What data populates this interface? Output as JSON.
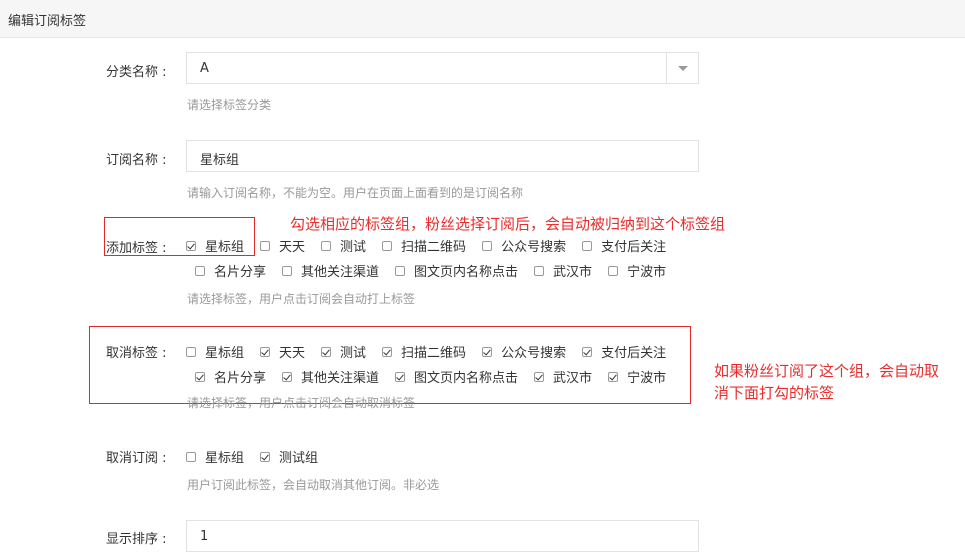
{
  "header": {
    "title": "编辑订阅标签"
  },
  "category": {
    "label": "分类名称 :",
    "value": "A",
    "hint": "请选择标签分类"
  },
  "sub_name": {
    "label": "订阅名称 :",
    "value": "星标组",
    "hint": "请输入订阅名称，不能为空。用户在页面上面看到的是订阅名称"
  },
  "add_tags": {
    "label": "添加标签 :",
    "hint": "请选择标签，用户点击订阅会自动打上标签",
    "row1": [
      {
        "label": "星标组",
        "checked": true
      },
      {
        "label": "天天",
        "checked": false
      },
      {
        "label": "测试",
        "checked": false
      },
      {
        "label": "扫描二维码",
        "checked": false
      },
      {
        "label": "公众号搜索",
        "checked": false
      },
      {
        "label": "支付后关注",
        "checked": false
      }
    ],
    "row2": [
      {
        "label": "名片分享",
        "checked": false
      },
      {
        "label": "其他关注渠道",
        "checked": false
      },
      {
        "label": "图文页内名称点击",
        "checked": false
      },
      {
        "label": "武汉市",
        "checked": false
      },
      {
        "label": "宁波市",
        "checked": false
      }
    ]
  },
  "remove_tags": {
    "label": "取消标签 :",
    "hint": "请选择标签，用户点击订阅会自动取消标签",
    "row1": [
      {
        "label": "星标组",
        "checked": false
      },
      {
        "label": "天天",
        "checked": true
      },
      {
        "label": "测试",
        "checked": true
      },
      {
        "label": "扫描二维码",
        "checked": true
      },
      {
        "label": "公众号搜索",
        "checked": true
      },
      {
        "label": "支付后关注",
        "checked": true
      }
    ],
    "row2": [
      {
        "label": "名片分享",
        "checked": true
      },
      {
        "label": "其他关注渠道",
        "checked": true
      },
      {
        "label": "图文页内名称点击",
        "checked": true
      },
      {
        "label": "武汉市",
        "checked": true
      },
      {
        "label": "宁波市",
        "checked": true
      }
    ]
  },
  "cancel_sub": {
    "label": "取消订阅 :",
    "hint": "用户订阅此标签，会自动取消其他订阅。非必选",
    "options": [
      {
        "label": "星标组",
        "checked": false
      },
      {
        "label": "测试组",
        "checked": true
      }
    ]
  },
  "sort": {
    "label": "显示排序 :",
    "value": "1"
  },
  "annotations": {
    "add_note": "勾选相应的标签组，粉丝选择订阅后，会自动被归纳到这个标签组",
    "remove_note_line1": "如果粉丝订阅了这个组，会自动取",
    "remove_note_line2": "消下面打勾的标签",
    "color": "#ea2c2c"
  }
}
